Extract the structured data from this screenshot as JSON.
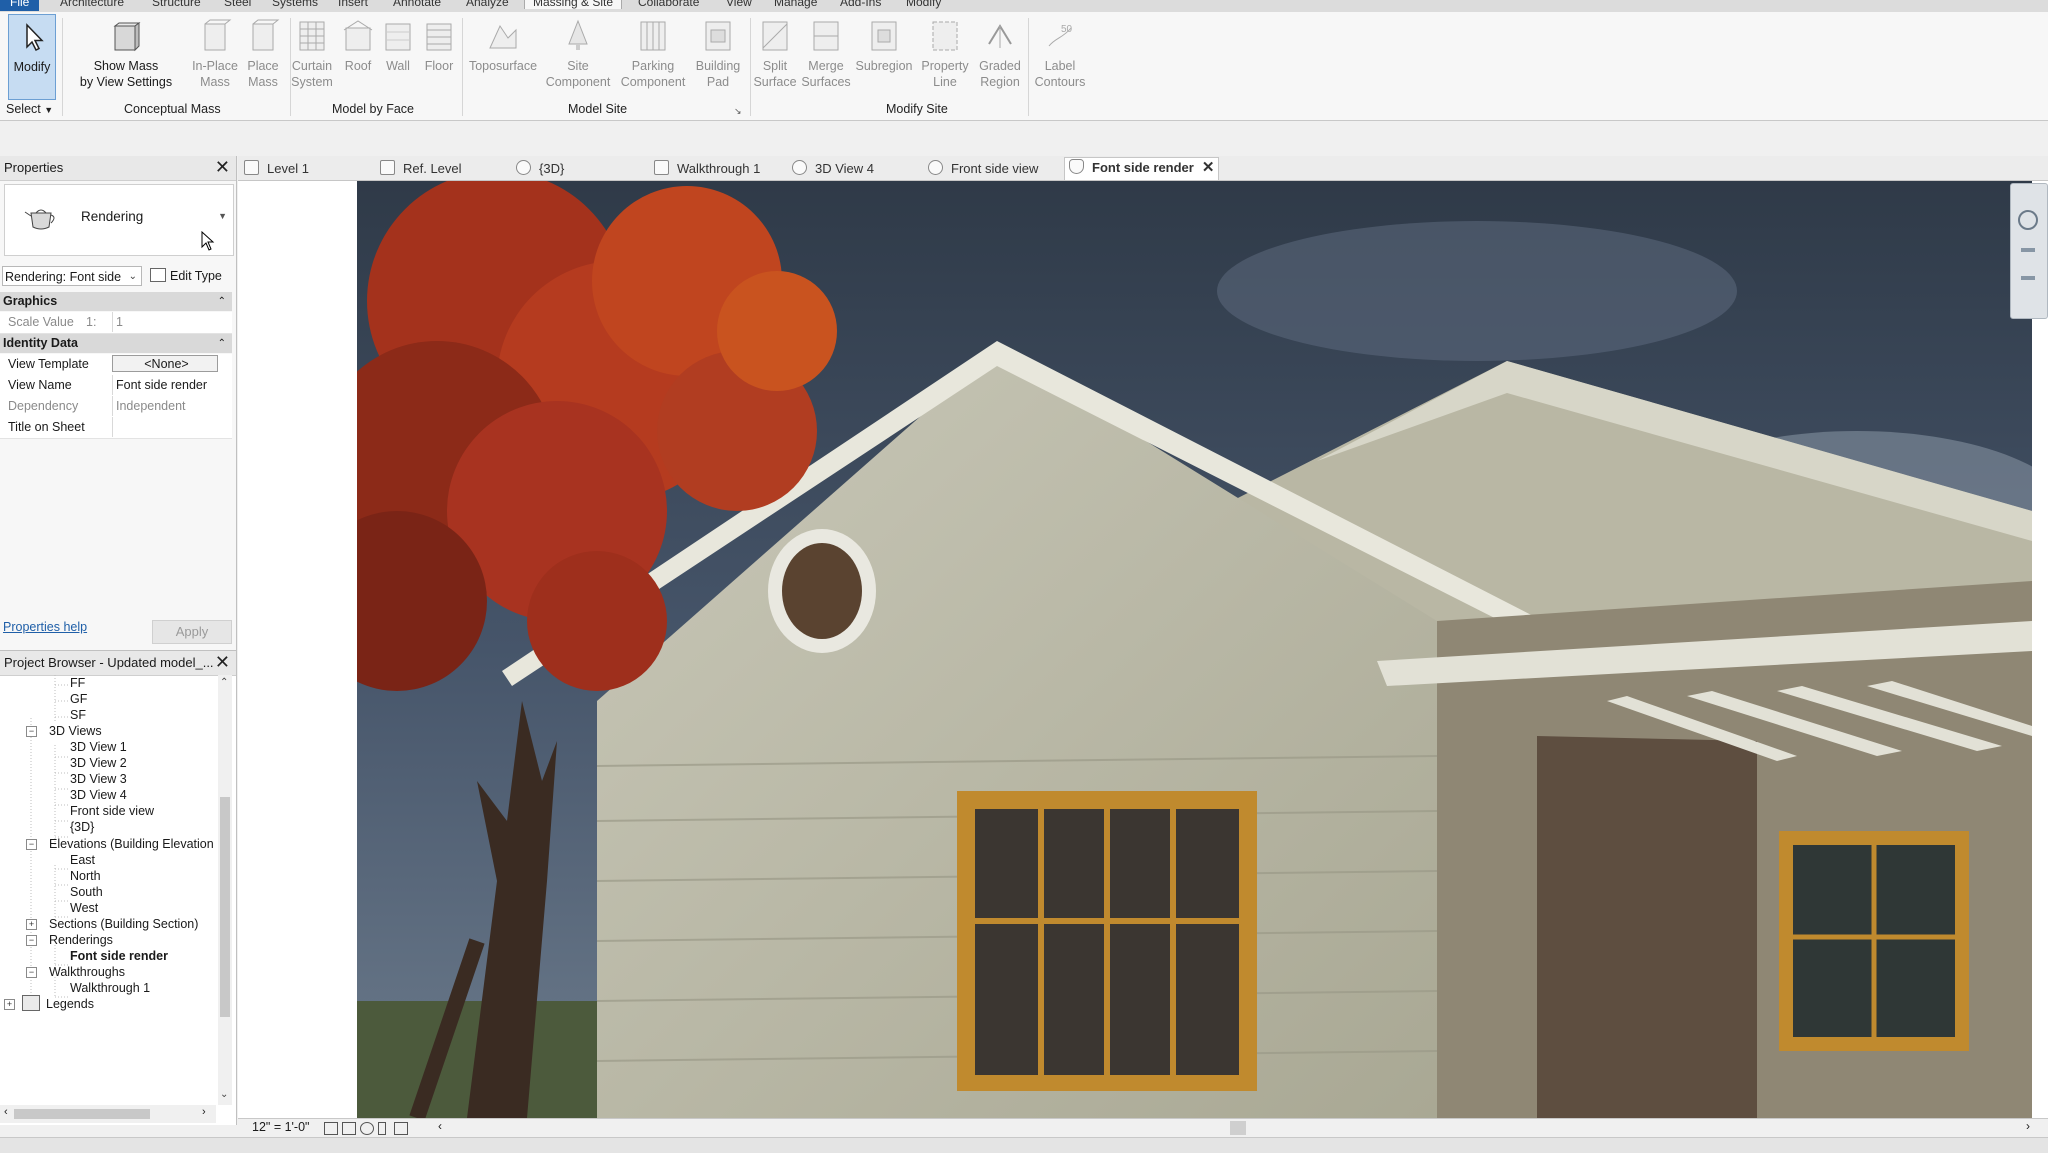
{
  "ribbon_tabs": [
    "File",
    "Architecture",
    "Structure",
    "Steel",
    "Systems",
    "Insert",
    "Annotate",
    "Analyze",
    "Massing & Site",
    "Collaborate",
    "View",
    "Manage",
    "Add-Ins",
    "Modify"
  ],
  "ribbon": {
    "modify": "Modify",
    "select": "Select",
    "show_mass": "Show Mass by View Settings",
    "show_mass_l1": "Show Mass",
    "show_mass_l2": "by View Settings",
    "inplace_l1": "In-Place",
    "inplace_l2": "Mass",
    "place_l1": "Place",
    "place_l2": "Mass",
    "curtain_l1": "Curtain",
    "curtain_l2": "System",
    "roof": "Roof",
    "wall": "Wall",
    "floor": "Floor",
    "toposurface": "Toposurface",
    "site_l1": "Site",
    "site_l2": "Component",
    "parking_l1": "Parking",
    "parking_l2": "Component",
    "pad_l1": "Building",
    "pad_l2": "Pad",
    "split_l1": "Split",
    "split_l2": "Surface",
    "merge_l1": "Merge",
    "merge_l2": "Surfaces",
    "subregion": "Subregion",
    "propline_l1": "Property",
    "propline_l2": "Line",
    "graded_l1": "Graded",
    "graded_l2": "Region",
    "label_l1": "Label",
    "label_l2": "Contours",
    "panels": [
      "Conceptual Mass",
      "Model by Face",
      "Model Site",
      "Modify Site"
    ]
  },
  "properties": {
    "title": "Properties",
    "type_name": "Rendering",
    "instance_filter": "Rendering: Font side",
    "edit_type": "Edit Type",
    "group_graphics": "Graphics",
    "scale_label": "Scale Value",
    "scale_prefix": "1:",
    "scale_value": "1",
    "group_identity": "Identity Data",
    "rows": [
      {
        "k": "View Template",
        "v": "<None>"
      },
      {
        "k": "View Name",
        "v": "Font side render"
      },
      {
        "k": "Dependency",
        "v": "Independent"
      },
      {
        "k": "Title on Sheet",
        "v": ""
      }
    ],
    "help": "Properties help",
    "apply": "Apply"
  },
  "browser": {
    "title": "Project Browser - Updated model_...",
    "items": [
      {
        "label": "FF"
      },
      {
        "label": "GF"
      },
      {
        "label": "SF"
      },
      {
        "label": "3D Views"
      },
      {
        "label": "3D View 1"
      },
      {
        "label": "3D View 2"
      },
      {
        "label": "3D View 3"
      },
      {
        "label": "3D View 4"
      },
      {
        "label": "Front side view"
      },
      {
        "label": "{3D}"
      },
      {
        "label": "Elevations (Building Elevation"
      },
      {
        "label": "East"
      },
      {
        "label": "North"
      },
      {
        "label": "South"
      },
      {
        "label": "West"
      },
      {
        "label": "Sections (Building Section)"
      },
      {
        "label": "Renderings"
      },
      {
        "label": "Font side render"
      },
      {
        "label": "Walkthroughs"
      },
      {
        "label": "Walkthrough 1"
      },
      {
        "label": "Legends"
      }
    ]
  },
  "view_tabs": [
    "Level 1",
    "Ref. Level",
    "{3D}",
    "Walkthrough 1",
    "3D View 4",
    "Front side view",
    "Font side render"
  ],
  "viewbar": {
    "scale": "12\" = 1'-0\""
  },
  "colors": {
    "accent": "#1f5fa8",
    "modify_bg": "#c6dcf2"
  }
}
